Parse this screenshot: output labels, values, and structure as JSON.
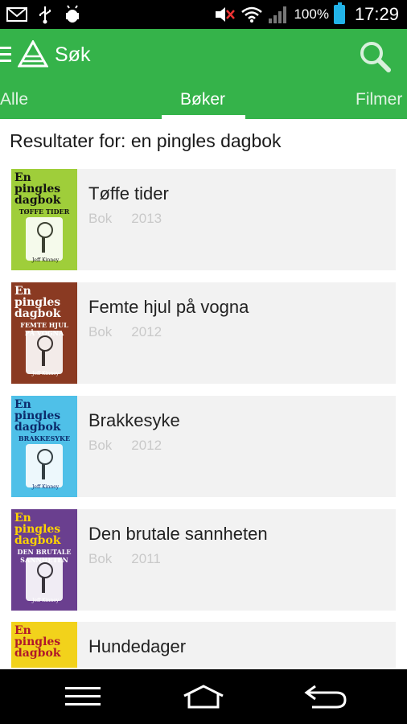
{
  "status_bar": {
    "icons": [
      "gmail-icon",
      "usb-icon",
      "android-debug-icon",
      "mute-icon",
      "wifi-icon",
      "signal-icon",
      "battery-icon"
    ],
    "battery_percent": "100%",
    "time": "17:29"
  },
  "app_bar": {
    "title": "Søk",
    "color": "#35b34a",
    "tabs": [
      {
        "label": "Alle"
      },
      {
        "label": "Bøker"
      },
      {
        "label": "Filmer"
      }
    ],
    "selected_tab": "Bøker"
  },
  "results": {
    "label": "Resultater for: en pingles dagbok",
    "items": [
      {
        "title": "Tøffe tider",
        "type": "Bok",
        "year": "2013",
        "cover_color": "#9fce3a",
        "cover_title": "En pingles dagbok",
        "cover_subtitle": "TØFFE TIDER",
        "cover_author": "Jeff Kinney"
      },
      {
        "title": "Femte hjul på vogna",
        "type": "Bok",
        "year": "2012",
        "cover_color": "#8a3a22",
        "cover_title": "En pingles dagbok",
        "cover_subtitle": "FEMTE HJUL PÅ VOGNA",
        "cover_author": "Jeff Kinney"
      },
      {
        "title": "Brakkesyke",
        "type": "Bok",
        "year": "2012",
        "cover_color": "#4fc0e8",
        "cover_title": "En pingles dagbok",
        "cover_subtitle": "BRAKKESYKE",
        "cover_author": "Jeff Kinney"
      },
      {
        "title": "Den brutale sannheten",
        "type": "Bok",
        "year": "2011",
        "cover_color": "#6a3f8f",
        "cover_title": "En pingles dagbok",
        "cover_subtitle": "DEN BRUTALE SANNHETEN",
        "cover_author": "Jeff Kinney"
      },
      {
        "title": "Hundedager",
        "type": "Bok",
        "year": "",
        "cover_color": "#f2d21b",
        "cover_title": "En pingles dagbok",
        "cover_subtitle": "",
        "cover_author": ""
      }
    ]
  },
  "nav_bar": {
    "buttons": [
      "menu-icon",
      "home-icon",
      "back-icon"
    ]
  }
}
